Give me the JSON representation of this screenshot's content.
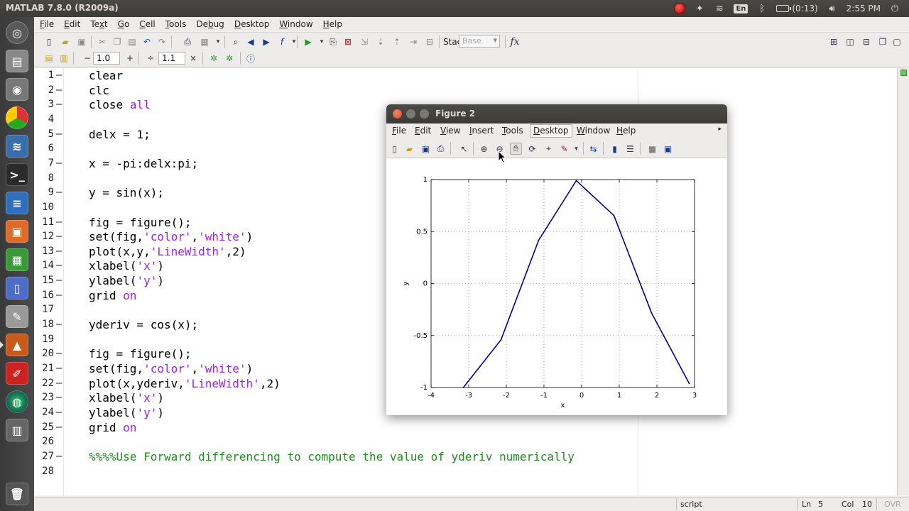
{
  "os": {
    "window_title": "MATLAB  7.8.0 (R2009a)",
    "keyboard_layout": "En",
    "battery": "(0:13)",
    "clock": "2:55 PM"
  },
  "menu": {
    "items": [
      "File",
      "Edit",
      "Text",
      "Go",
      "Cell",
      "Tools",
      "Debug",
      "Desktop",
      "Window",
      "Help"
    ],
    "mnemonics": [
      "F",
      "E",
      "x",
      "G",
      "C",
      "T",
      "b",
      "D",
      "W",
      "H"
    ]
  },
  "toolbar": {
    "stack_label": "Stack:",
    "stack_value": "Base",
    "fx_label": "fx",
    "cell_minus": "−",
    "cell_decrement": "1.0",
    "cell_plus": "+",
    "cell_divide": "÷",
    "cell_increment": "1.1",
    "cell_times": "×"
  },
  "editor": {
    "lines": [
      [
        {
          "t": "clear",
          "c": ""
        }
      ],
      [
        {
          "t": "clc",
          "c": ""
        }
      ],
      [
        {
          "t": "close ",
          "c": ""
        },
        {
          "t": "all",
          "c": "str"
        }
      ],
      [],
      [
        {
          "t": "delx = 1;",
          "c": ""
        }
      ],
      [],
      [
        {
          "t": "x = -pi:delx:pi;",
          "c": ""
        }
      ],
      [],
      [
        {
          "t": "y = sin(x);",
          "c": ""
        }
      ],
      [],
      [
        {
          "t": "fig = figure();",
          "c": ""
        }
      ],
      [
        {
          "t": "set(fig,",
          "c": ""
        },
        {
          "t": "'color'",
          "c": "str"
        },
        {
          "t": ",",
          "c": ""
        },
        {
          "t": "'white'",
          "c": "str"
        },
        {
          "t": ")",
          "c": ""
        }
      ],
      [
        {
          "t": "plot(x,y,",
          "c": ""
        },
        {
          "t": "'LineWidth'",
          "c": "str"
        },
        {
          "t": ",2)",
          "c": ""
        }
      ],
      [
        {
          "t": "xlabel(",
          "c": ""
        },
        {
          "t": "'x'",
          "c": "str"
        },
        {
          "t": ")",
          "c": ""
        }
      ],
      [
        {
          "t": "ylabel(",
          "c": ""
        },
        {
          "t": "'y'",
          "c": "str"
        },
        {
          "t": ")",
          "c": ""
        }
      ],
      [
        {
          "t": "grid ",
          "c": ""
        },
        {
          "t": "on",
          "c": "str"
        }
      ],
      [],
      [
        {
          "t": "yderiv = cos(x);",
          "c": ""
        }
      ],
      [],
      [
        {
          "t": "fig = figure();",
          "c": ""
        }
      ],
      [
        {
          "t": "set(fig,",
          "c": ""
        },
        {
          "t": "'color'",
          "c": "str"
        },
        {
          "t": ",",
          "c": ""
        },
        {
          "t": "'white'",
          "c": "str"
        },
        {
          "t": ")",
          "c": ""
        }
      ],
      [
        {
          "t": "plot(x,yderiv,",
          "c": ""
        },
        {
          "t": "'LineWidth'",
          "c": "str"
        },
        {
          "t": ",2)",
          "c": ""
        }
      ],
      [
        {
          "t": "xlabel(",
          "c": ""
        },
        {
          "t": "'x'",
          "c": "str"
        },
        {
          "t": ")",
          "c": ""
        }
      ],
      [
        {
          "t": "ylabel(",
          "c": ""
        },
        {
          "t": "'y'",
          "c": "str"
        },
        {
          "t": ")",
          "c": ""
        }
      ],
      [
        {
          "t": "grid ",
          "c": ""
        },
        {
          "t": "on",
          "c": "str"
        }
      ],
      [],
      [
        {
          "t": "%%%%Use Forward differencing to compute the value of yderiv numerically",
          "c": "cmt"
        }
      ],
      []
    ]
  },
  "statusbar": {
    "mode": "script",
    "ln_label": "Ln",
    "ln_value": "5",
    "col_label": "Col",
    "col_value": "10",
    "ovr": "OVR"
  },
  "figure": {
    "title": "Figure 2",
    "menu": [
      "File",
      "Edit",
      "View",
      "Insert",
      "Tools",
      "Desktop",
      "Window",
      "Help"
    ],
    "mnemonics": [
      "F",
      "E",
      "V",
      "I",
      "T",
      "D",
      "W",
      "H"
    ]
  },
  "chart_data": {
    "type": "line",
    "x": [
      -3.1416,
      -2.1416,
      -1.1416,
      -0.1416,
      0.8584,
      1.8584,
      2.8584
    ],
    "series": [
      {
        "values": [
          -1.0,
          -0.5403,
          0.4161,
          0.99,
          0.6536,
          -0.2837,
          -0.9602
        ],
        "color": "#00008b"
      }
    ],
    "title": "",
    "xlabel": "x",
    "ylabel": "y",
    "xlim": [
      -4,
      3
    ],
    "ylim": [
      -1,
      1
    ],
    "xticks": [
      "-4",
      "-3",
      "-2",
      "-1",
      "0",
      "1",
      "2",
      "3"
    ],
    "yticks": [
      "-1",
      "-0.5",
      "0",
      "0.5",
      "1"
    ],
    "grid": true
  }
}
